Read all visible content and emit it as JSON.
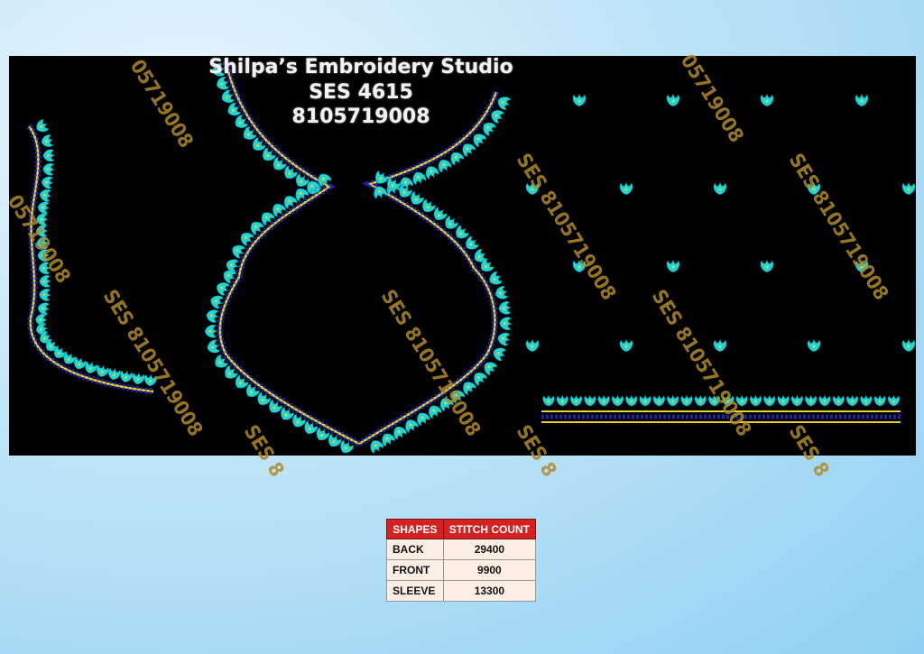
{
  "header": {
    "studio_name": "Shilpa’s Embroidery Studio",
    "design_code": "SES  4615",
    "phone": "8105719008"
  },
  "watermark": {
    "full": "SES 8105719008",
    "partial_1": "05719008",
    "partial_2": "SES 8"
  },
  "table": {
    "headers": [
      "SHAPES",
      "STITCH COUNT"
    ],
    "rows": [
      {
        "shape": "BACK",
        "count": "29400"
      },
      {
        "shape": "FRONT",
        "count": "9900"
      },
      {
        "shape": "SLEEVE",
        "count": "13300"
      }
    ]
  },
  "colors": {
    "background": "#000000",
    "motif": "#1ed6d6",
    "outline_gold": "#e3d12a",
    "beads_navy": "#1e22a8",
    "table_header": "#d42121",
    "table_cell": "#fdeee6",
    "watermark": "#b08a2a"
  }
}
